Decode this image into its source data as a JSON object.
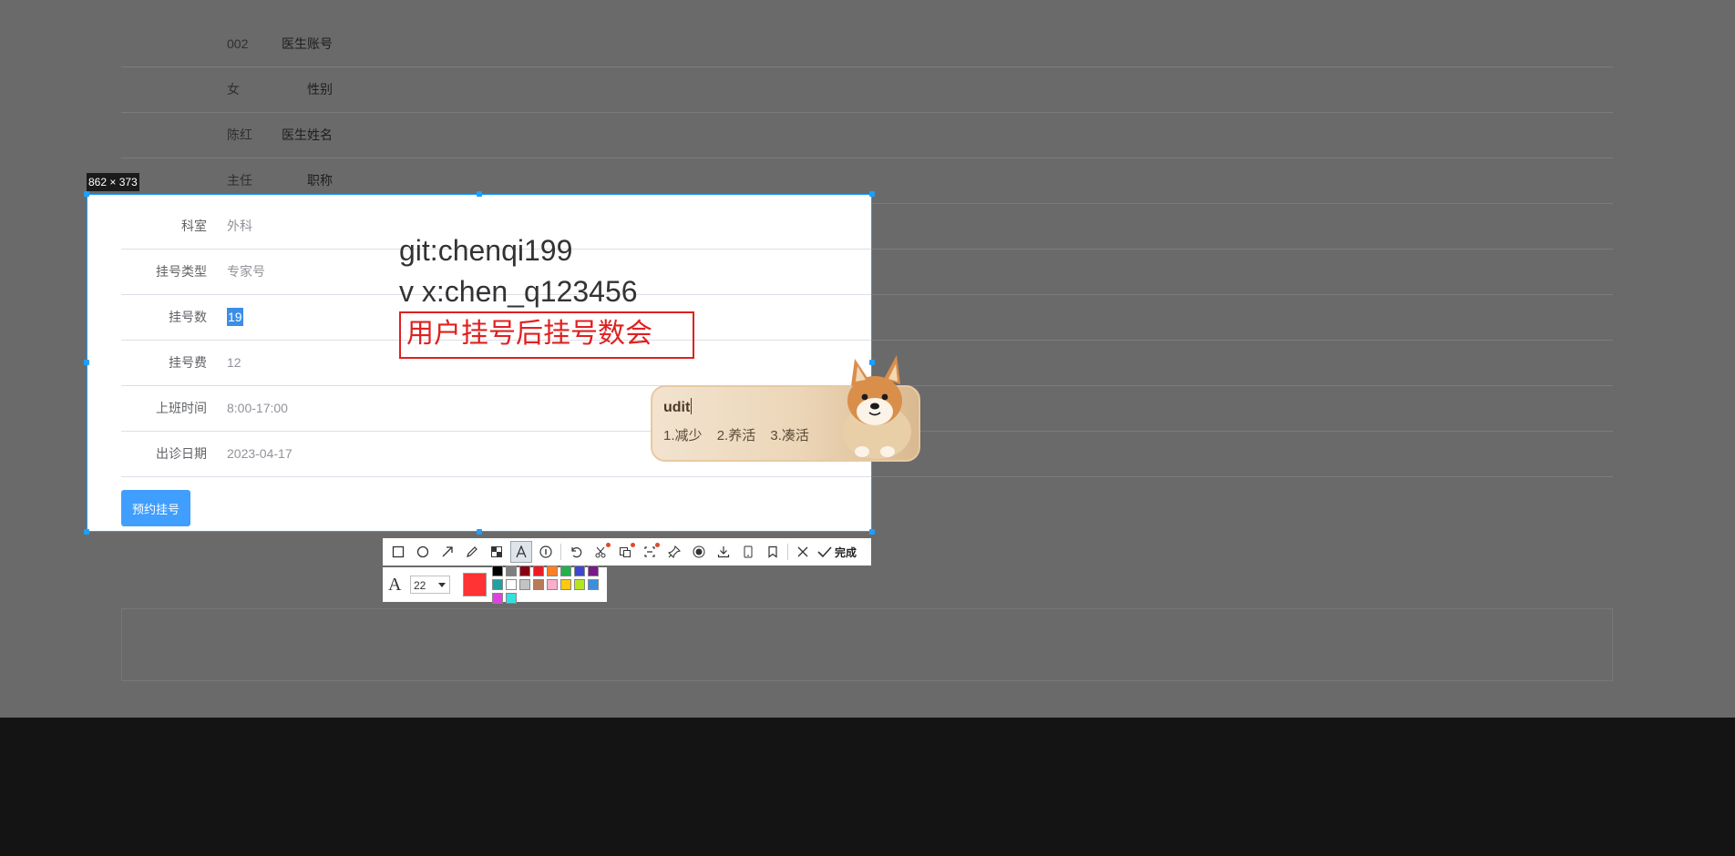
{
  "form": {
    "rows_dimmed_top": [
      {
        "label": "医生账号",
        "value": "002"
      },
      {
        "label": "性别",
        "value": "女"
      },
      {
        "label": "医生姓名",
        "value": "陈红"
      },
      {
        "label": "职称",
        "value": "主任"
      }
    ],
    "rows_lit": [
      {
        "label": "科室",
        "value": "外科"
      },
      {
        "label": "挂号类型",
        "value": "专家号"
      },
      {
        "label": "挂号数",
        "value": "19"
      },
      {
        "label": "挂号费",
        "value": "12"
      },
      {
        "label": "上班时间",
        "value": "8:00-17:00"
      },
      {
        "label": "出诊日期",
        "value": "2023-04-17"
      }
    ],
    "book_button": "预约挂号"
  },
  "screenshot": {
    "size_label": "862 × 373",
    "selection_color": "#1e9fff",
    "annotations": {
      "line1": "git:chenqi199",
      "line2": "v x:chen_q123456",
      "red_text": "用户挂号后挂号数会",
      "red_color": "#e02020"
    },
    "ime": {
      "composition": "udit",
      "candidates": [
        "1.减少",
        "2.养活",
        "3.凑活"
      ]
    },
    "toolbar": {
      "tools": [
        {
          "icon": "rectangle-icon"
        },
        {
          "icon": "ellipse-icon"
        },
        {
          "icon": "arrow-icon"
        },
        {
          "icon": "pencil-icon"
        },
        {
          "icon": "mosaic-icon"
        },
        {
          "icon": "text-icon",
          "active": true
        },
        {
          "icon": "serial-number-icon"
        },
        {
          "icon": "undo-icon"
        },
        {
          "icon": "scissors-icon"
        },
        {
          "icon": "ocr-icon"
        },
        {
          "icon": "long-screenshot-icon"
        },
        {
          "icon": "pin-icon"
        },
        {
          "icon": "record-icon"
        },
        {
          "icon": "download-icon"
        },
        {
          "icon": "phone-icon"
        },
        {
          "icon": "bookmark-icon"
        },
        {
          "icon": "close-icon"
        }
      ],
      "done_label": "完成"
    },
    "text_settings": {
      "font_size": "22",
      "current_color": "#ff3333",
      "palette": [
        "#000000",
        "#7f7f7f",
        "#880015",
        "#ed1c24",
        "#ff7f27",
        "#22b14c",
        "#3f48cc",
        "#7a1a8a",
        "#20a0a0",
        "#ffffff",
        "#c3c3c3",
        "#b97a57",
        "#ffaec9",
        "#ffc90e",
        "#b5e61d",
        "#3b8fe0",
        "#e040e0",
        "#33e0e0"
      ]
    }
  }
}
